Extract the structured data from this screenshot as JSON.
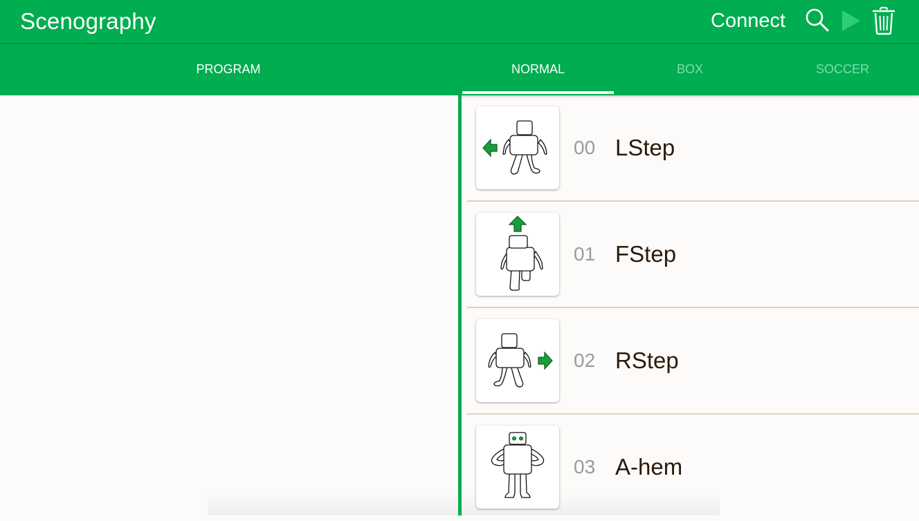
{
  "app": {
    "title": "Scenography",
    "connect_label": "Connect"
  },
  "toolbar": {
    "icons": [
      "search-icon",
      "play-icon",
      "trash-icon"
    ],
    "play_color": "#2ccf78"
  },
  "tabs": {
    "program": "PROGRAM",
    "normal": "NORMAL",
    "box": "BOX",
    "soccer": "SOCCER",
    "active": "NORMAL"
  },
  "colors": {
    "primary": "#00ad50",
    "tab_inactive": "#7fdcae",
    "separator": "#ddd2bf",
    "text_dark": "#2a1a0c",
    "text_number": "#9a9a9a",
    "arrow": "#1a9e3c"
  },
  "motions": [
    {
      "number": "00",
      "name": "LStep",
      "icon": "robot-step-left-icon"
    },
    {
      "number": "01",
      "name": "FStep",
      "icon": "robot-step-forward-icon"
    },
    {
      "number": "02",
      "name": "RStep",
      "icon": "robot-step-right-icon"
    },
    {
      "number": "03",
      "name": "A-hem",
      "icon": "robot-ahem-icon"
    }
  ]
}
